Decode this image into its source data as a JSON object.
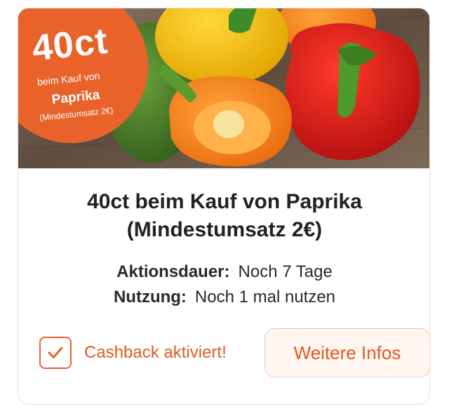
{
  "offer": {
    "badge": {
      "amount": "40ct",
      "subtitle": "beim Kauf von",
      "product": "Paprika",
      "minimum": "(Mindestumsatz 2€)"
    },
    "title_line1": "40ct beim Kauf von Paprika",
    "title_line2": "(Mindestumsatz 2€)",
    "details": {
      "duration_label": "Aktionsdauer:",
      "duration_value": "Noch 7 Tage",
      "usage_label": "Nutzung:",
      "usage_value": "Noch 1 mal nutzen"
    },
    "cashback_status": "Cashback aktiviert!",
    "cashback_checked": true,
    "more_button": "Weitere Infos"
  },
  "colors": {
    "accent": "#e8622a",
    "accent_text": "#e05a1f",
    "button_bg": "#fff6f2",
    "title_text": "#222222"
  },
  "icons": {
    "checkbox": "check-icon"
  }
}
